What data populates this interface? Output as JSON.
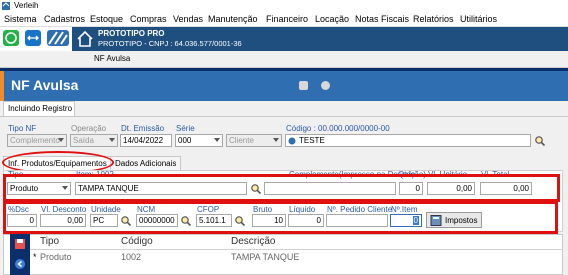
{
  "window": {
    "title": "Verleih"
  },
  "menu": [
    "Sistema",
    "Cadastros",
    "Estoque",
    "Compras",
    "Vendas",
    "Manutenção",
    "Financeiro",
    "Locação",
    "Notas Fiscais",
    "Relatórios",
    "Utilitários"
  ],
  "company": {
    "name": "PROTOTIPO PRO",
    "sub": "PROTOTIPO - CNPJ : 64.036.577/0001-36"
  },
  "tab": {
    "label": "NF Avulsa"
  },
  "header": {
    "title": "NF Avulsa"
  },
  "mode_tab": {
    "label": "Incluindo Registro"
  },
  "form": {
    "tipo_nf": {
      "label": "Tipo NF",
      "value": "Complemento"
    },
    "operacao": {
      "label": "Operação",
      "value": "Saída"
    },
    "dt_emissao": {
      "label": "Dt. Emissão",
      "value": "14/04/2022"
    },
    "serie": {
      "label": "Série",
      "value": "000"
    },
    "cliente": {
      "value": "Cliente"
    },
    "codigo": {
      "label": "Código : 00.000.000/0000-00",
      "value": "TESTE"
    }
  },
  "subtabs": [
    "Inf. Produtos/Equipamentos",
    "Dados Adicionais"
  ],
  "produto": {
    "tipo": {
      "label": "Tipo",
      "value": "Produto"
    },
    "item": {
      "label": "Item: 1002",
      "value": "TAMPA TANQUE"
    },
    "complemento": {
      "label": "Complemento(Impresso na Descrição)"
    },
    "qtde": {
      "label": "Qtde",
      "value": "0"
    },
    "vl_unitario": {
      "label": "Vl. Unitário",
      "value": "0,00"
    },
    "vl_total": {
      "label": "Vl. Total",
      "value": "0,00"
    },
    "pct_dsc": {
      "label": "%Dsc",
      "value": "0"
    },
    "vl_desconto": {
      "label": "Vl. Desconto",
      "value": "0,00"
    },
    "unidade": {
      "label": "Unidade",
      "value": "PC"
    },
    "ncm": {
      "label": "NCM",
      "value": "00000000"
    },
    "cfop": {
      "label": "CFOP",
      "value": "5.101.1"
    },
    "bruto": {
      "label": "Bruto",
      "value": "10"
    },
    "liquido": {
      "label": "Líquido",
      "value": "0"
    },
    "pedido_cliente": {
      "label": "Nº. Pedido Cliente",
      "value": ""
    },
    "n_item": {
      "label": "Nº.Item",
      "value": "0"
    },
    "impostos_label": "Impostos"
  },
  "grid": {
    "columns": [
      "Tipo",
      "Código",
      "Descrição"
    ],
    "rows": [
      {
        "marker": "*",
        "tipo": "Produto",
        "codigo": "1002",
        "descricao": "TAMPA TANQUE"
      }
    ]
  },
  "colors": {
    "header": "#2f6eb0",
    "accent": "#f28c28",
    "company_bar": "#1e4f7e",
    "highlight": "#e01010"
  }
}
